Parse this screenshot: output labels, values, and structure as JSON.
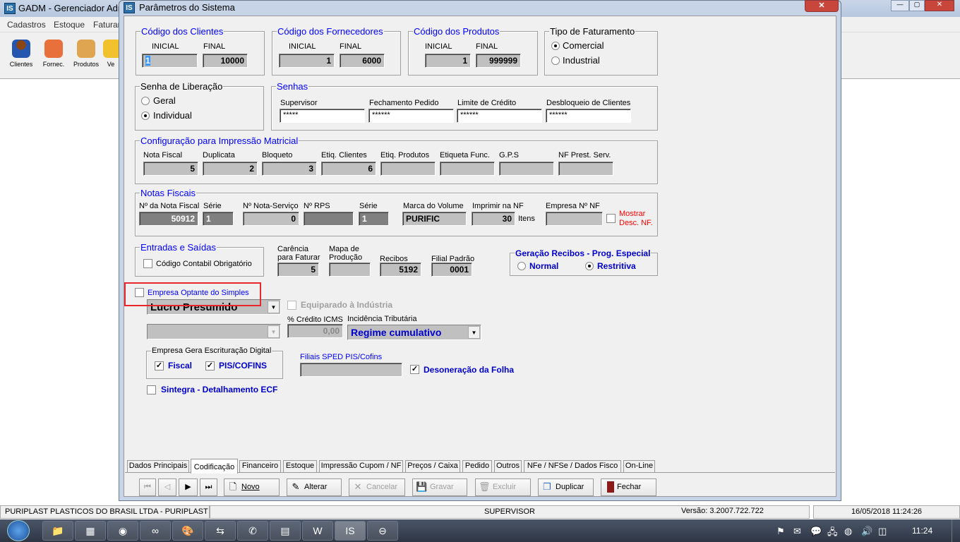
{
  "main_window": {
    "title": "GADM - Gerenciador Admi",
    "menu": [
      "Cadastros",
      "Estoque",
      "Faturam"
    ],
    "toolbar": [
      {
        "label": "Clientes",
        "icon": "person-icon"
      },
      {
        "label": "Fornec.",
        "icon": "house-icon"
      },
      {
        "label": "Produtos",
        "icon": "box-icon"
      },
      {
        "label": "Ve",
        "icon": "star-icon"
      }
    ]
  },
  "dialog": {
    "title": "Parâmetros do Sistema",
    "codigo_clientes": {
      "legend": "Código dos Clientes",
      "inicial_label": "INICIAL",
      "final_label": "FINAL",
      "inicial": "1",
      "final": "10000"
    },
    "codigo_fornecedores": {
      "legend": "Código dos Fornecedores",
      "inicial_label": "INICIAL",
      "final_label": "FINAL",
      "inicial": "1",
      "final": "6000"
    },
    "codigo_produtos": {
      "legend": "Código dos Produtos",
      "inicial_label": "INICIAL",
      "final_label": "FINAL",
      "inicial": "1",
      "final": "999999"
    },
    "tipo_faturamento": {
      "legend": "Tipo de Faturamento",
      "options": [
        "Comercial",
        "Industrial"
      ],
      "selected": "Comercial"
    },
    "senha_liberacao": {
      "legend": "Senha de Liberação",
      "options": [
        "Geral",
        "Individual"
      ],
      "selected": "Individual"
    },
    "senhas": {
      "legend": "Senhas",
      "fields": [
        {
          "label": "Supervisor",
          "value": "*****"
        },
        {
          "label": "Fechamento Pedido",
          "value": "******"
        },
        {
          "label": "Limite de Crédito",
          "value": "******"
        },
        {
          "label": "Desbloqueio de Clientes",
          "value": "******"
        }
      ]
    },
    "impressao_matricial": {
      "legend": "Configuração para Impressão Matricial",
      "fields": [
        {
          "label": "Nota Fiscal",
          "value": "5"
        },
        {
          "label": "Duplicata",
          "value": "2"
        },
        {
          "label": "Bloqueto",
          "value": "3"
        },
        {
          "label": "Etiq. Clientes",
          "value": "6"
        },
        {
          "label": "Etiq. Produtos",
          "value": ""
        },
        {
          "label": "Etiqueta Func.",
          "value": ""
        },
        {
          "label": "G.P.S",
          "value": ""
        },
        {
          "label": "NF Prest. Serv.",
          "value": ""
        }
      ]
    },
    "notas_fiscais": {
      "legend": "Notas Fiscais",
      "nota_fiscal_label": "Nº da Nota Fiscal",
      "nota_fiscal": "50912",
      "serie_label": "Série",
      "serie": "1",
      "nota_servico_label": "Nº Nota-Serviço",
      "nota_servico": "0",
      "rps_label": "Nº RPS",
      "rps": "",
      "serie2_label": "Série",
      "serie2": "1",
      "marca_label": "Marca do Volume",
      "marca": "PURIFIC",
      "imprimir_label": "Imprimir na NF",
      "imprimir": "30",
      "itens": "Itens",
      "empresa_label": "Empresa Nº NF",
      "empresa": "",
      "mostrar_desc": "Mostrar Desc. NF.",
      "mostrar_checked": false,
      "mostrar_color": "#ff0000"
    },
    "entradas_saidas": {
      "legend": "Entradas e Saídas",
      "codigo_contabil": "Código Contabil Obrigatório",
      "checked": false
    },
    "carencia": {
      "label": "Carência para Faturar",
      "value": "5"
    },
    "mapa": {
      "label": "Mapa de Produção",
      "value": ""
    },
    "recibos": {
      "label": "Recibos",
      "value": "5192"
    },
    "filial": {
      "label": "Filial Padrão",
      "value": "0001"
    },
    "geracao_recibos": {
      "legend": "Geração Recibos - Prog. Especial",
      "options": [
        "Normal",
        "Restritiva"
      ],
      "selected": "Restritiva"
    },
    "optante_simples": {
      "label": "Empresa Optante do Simples",
      "checked": false,
      "highlight_color": "#ff0000"
    },
    "regime": {
      "value": "Lucro Presumido"
    },
    "regime2": {
      "value": ""
    },
    "equiparado": {
      "label": "Equiparado à Indústria",
      "checked": false,
      "disabled": true
    },
    "credito_icms": {
      "label": "% Crédito ICMS",
      "value": "0,00"
    },
    "incidencia": {
      "label": "Incidência Tributária",
      "value": "Regime cumulativo"
    },
    "escrituracao": {
      "legend": "Empresa Gera Escrituração Digital",
      "fiscal": "Fiscal",
      "fiscal_checked": true,
      "pis": "PIS/COFINS",
      "pis_checked": true
    },
    "filiais_sped": {
      "label": "Filiais SPED PIS/Cofins",
      "value": ""
    },
    "desoneracao": {
      "label": "Desoneração da Folha",
      "checked": true
    },
    "sintegra": {
      "label": "Sintegra - Detalhamento ECF",
      "checked": false
    },
    "tabs": [
      "Dados Principais",
      "Codificação",
      "Financeiro",
      "Estoque",
      "Impressão Cupom / NF",
      "Preços / Caixa",
      "Pedido",
      "Outros",
      "NFe / NFSe / Dados Fisco",
      "On-Line"
    ],
    "active_tab": "Codificação",
    "buttons": {
      "novo": "Novo",
      "alterar": "Alterar",
      "cancelar": "Cancelar",
      "gravar": "Gravar",
      "excluir": "Excluir",
      "duplicar": "Duplicar",
      "fechar": "Fechar"
    }
  },
  "status_bar": {
    "company": "PURIPLAST PLASTICOS DO BRASIL LTDA  -  PURIPLAST",
    "user": "SUPERVISOR",
    "version": "Versão: 3.2007.722.722",
    "datetime": "16/05/2018 11:24:26"
  },
  "taskbar": {
    "clock": "11:24"
  }
}
